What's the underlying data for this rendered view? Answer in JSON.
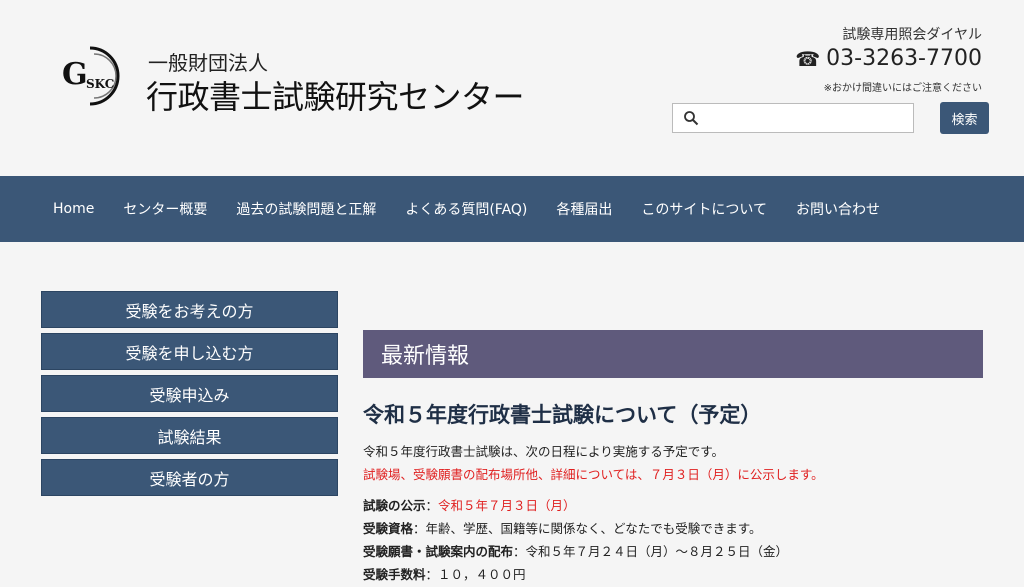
{
  "header": {
    "logo_text": "GSKC",
    "org_sub": "一般財団法人",
    "org_name": "行政書士試験研究センター",
    "dial_label": "試験専用照会ダイヤル",
    "phone": "03-3263-7700",
    "dial_note": "※おかけ間違いにはご注意ください",
    "search": {
      "placeholder": "",
      "value": "",
      "button_label": "検索"
    }
  },
  "nav": {
    "items": [
      {
        "label": "Home"
      },
      {
        "label": "センター概要"
      },
      {
        "label": "過去の試験問題と正解"
      },
      {
        "label": "よくある質問(FAQ)"
      },
      {
        "label": "各種届出"
      },
      {
        "label": "このサイトについて"
      },
      {
        "label": "お問い合わせ"
      }
    ]
  },
  "sidebar": {
    "items": [
      {
        "label": "受験をお考えの方"
      },
      {
        "label": "受験を申し込む方"
      },
      {
        "label": "受験申込み"
      },
      {
        "label": "試験結果"
      },
      {
        "label": "受験者の方"
      }
    ]
  },
  "main": {
    "section_title": "最新情報",
    "article_title": "令和５年度行政書士試験について（予定）",
    "intro": "令和５年度行政書士試験は、次の日程により実施する予定です。",
    "intro_red": "試験場、受験願書の配布場所他、詳細については、７月３日（月）に公示します。",
    "details": [
      {
        "key": "試験の公示",
        "sep": "：",
        "value": "令和５年７月３日（月）",
        "red": true
      },
      {
        "key": "受験資格",
        "sep": "：",
        "value": "年齢、学歴、国籍等に関係なく、どなたでも受験できます。",
        "red": false
      },
      {
        "key": "受験願書・試験案内の配布",
        "sep": "：",
        "value": "令和５年７月２４日（月）～８月２５日（金）",
        "red": false
      },
      {
        "key": "受験手数料",
        "sep": "：",
        "value": "１０，４００円",
        "red": false
      }
    ]
  },
  "colors": {
    "nav_bg": "#3b5777",
    "section_title_bg": "#5f5a7c",
    "notice_red": "#e02020",
    "page_bg": "#f5f5f5"
  }
}
